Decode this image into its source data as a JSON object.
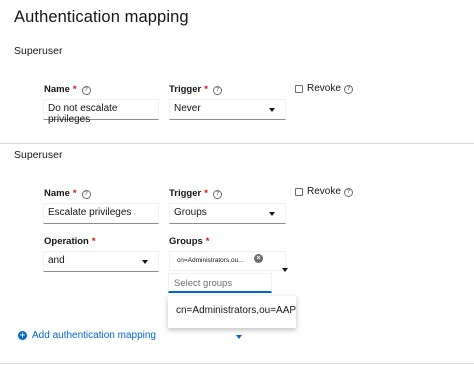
{
  "page_title": "Authentication mapping",
  "mappings": [
    {
      "section_title": "Superuser",
      "name_label": "Name",
      "name_value": "Do not escalate privileges",
      "trigger_label": "Trigger",
      "trigger_value": "Never",
      "revoke_label": "Revoke",
      "revoke_checked": false
    },
    {
      "section_title": "Superuser",
      "name_label": "Name",
      "name_value": "Escalate privileges",
      "trigger_label": "Trigger",
      "trigger_value": "Groups",
      "revoke_label": "Revoke",
      "revoke_checked": false,
      "operation_label": "Operation",
      "operation_value": "and",
      "groups_label": "Groups",
      "groups_chip": "cn=Administrators,ou...",
      "groups_placeholder": "Select groups",
      "groups_menu_option": "cn=Administrators,ou=AAP"
    }
  ],
  "required_mark": "*",
  "help_glyph": "?",
  "add_mapping_label": "Add authentication mapping",
  "colors": {
    "accent": "#0066cc",
    "required": "#c9190b",
    "text": "#151515"
  },
  "icons": {
    "help": "help-icon",
    "chip_close": "close-icon",
    "add": "plus-circle-icon",
    "dropdown": "caret-down-icon"
  }
}
